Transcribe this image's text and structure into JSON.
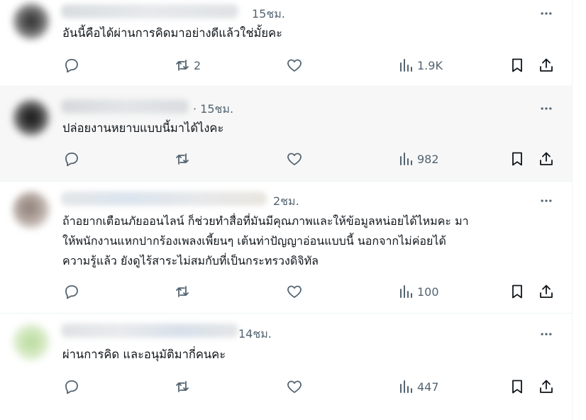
{
  "colors": {
    "icon": "#536471",
    "text": "#0f1419",
    "highlight_bg": "#f7f7f7",
    "divider": "#eff3f4"
  },
  "replies": [
    {
      "time": "15ชม.",
      "text": "อันนี้คือได้ผ่านการคิดมาอย่างดีแล้วใช่มั้ยคะ",
      "reply_count": "",
      "retweet_count": "2",
      "like_count": "",
      "views": "1.9K",
      "highlighted": false
    },
    {
      "time": "· 15ชม.",
      "text": "ปล่อยงานหยาบแบบนี้มาได้ไงคะ",
      "reply_count": "",
      "retweet_count": "",
      "like_count": "",
      "views": "982",
      "highlighted": true
    },
    {
      "time": "2ชม.",
      "text": "ถ้าอยากเตือนภัยออนไลน์ ก็ช่วยทำสื่อที่มันมีคุณภาพและให้ข้อมูลหน่อยได้ไหมคะ มา\nให้พนักงานแหกปากร้องเพลงเพี้ยนๆ เต้นท่าปัญญาอ่อนแบบนี้ นอกจากไม่ค่อยได้\nความรู้แล้ว ยังดูไร้สาระไม่สมกับที่เป็นกระทรวงดิจิทัล",
      "reply_count": "",
      "retweet_count": "",
      "like_count": "",
      "views": "100",
      "highlighted": false
    },
    {
      "time": "14ชม.",
      "text": "ผ่านการคิด และอนุมัติมากี่คนคะ",
      "reply_count": "",
      "retweet_count": "",
      "like_count": "",
      "views": "447",
      "highlighted": false
    }
  ],
  "icons": {
    "reply": "reply-icon",
    "retweet": "retweet-icon",
    "like": "heart-icon",
    "views": "views-chart-icon",
    "bookmark": "bookmark-icon",
    "share": "share-icon",
    "more": "more-icon"
  }
}
